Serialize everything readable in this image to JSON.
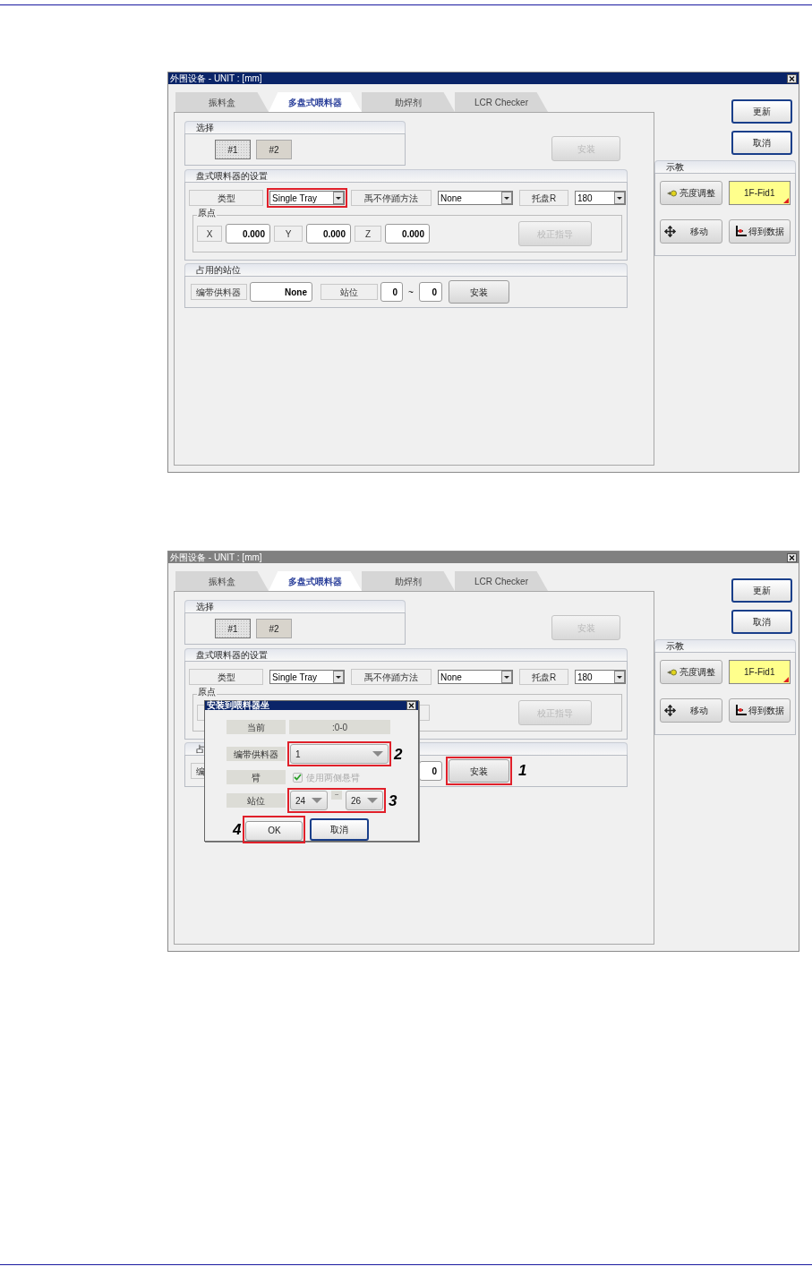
{
  "screens": [
    {
      "window": {
        "title": "外围设备 - UNIT : [mm]",
        "active": true
      },
      "tabs": [
        {
          "label": "振料盒",
          "selected": false
        },
        {
          "label": "多盘式喂料器",
          "selected": true
        },
        {
          "label": "助焊剂",
          "selected": false
        },
        {
          "label": "LCR Checker",
          "selected": false
        }
      ],
      "select_group": {
        "title": "选择",
        "buttons": [
          {
            "label": "#1",
            "selected": true
          },
          {
            "label": "#2",
            "selected": false
          }
        ]
      },
      "install_button": {
        "label": "安装",
        "disabled": true
      },
      "settings": {
        "title": "盘式喂料器的设置",
        "type_label": "类型",
        "type_select": {
          "value": "Single Tray",
          "highlighted": true
        },
        "method_label": "禹不停踊方法",
        "method_select": {
          "value": "None",
          "highlighted": false
        },
        "tray_label": "托盘R",
        "tray_select": {
          "value": "180",
          "highlighted": false
        },
        "origin": {
          "title": "原点",
          "x_label": "X",
          "x_value": "0.000",
          "y_label": "Y",
          "y_value": "0.000",
          "z_label": "Z",
          "z_value": "0.000",
          "calibrate_button": {
            "label": "校正指导",
            "disabled": true
          }
        }
      },
      "occupied": {
        "title": "占用的站位",
        "feeder_label": "编带供料器",
        "feeder_value": "None",
        "station_label": "站位",
        "from": "0",
        "separator": "~",
        "to": "0",
        "install_button": {
          "label": "安装",
          "highlighted": false
        }
      },
      "side": {
        "buttons": [
          "更新",
          "取消"
        ],
        "teach": {
          "title": "示教",
          "brightness": "亮度调整",
          "mark": "1F-Fid1",
          "move": "移动",
          "get_data": "得到数据"
        }
      }
    },
    {
      "window": {
        "title": "外围设备 - UNIT : [mm]",
        "active": false
      },
      "tabs": [
        {
          "label": "振料盒",
          "selected": false
        },
        {
          "label": "多盘式喂料器",
          "selected": true
        },
        {
          "label": "助焊剂",
          "selected": false
        },
        {
          "label": "LCR Checker",
          "selected": false
        }
      ],
      "select_group": {
        "title": "选择",
        "buttons": [
          {
            "label": "#1",
            "selected": true
          },
          {
            "label": "#2",
            "selected": false
          }
        ]
      },
      "install_button": {
        "label": "安装",
        "disabled": true
      },
      "settings": {
        "title": "盘式喂料器的设置",
        "type_label": "类型",
        "type_select": {
          "value": "Single Tray",
          "highlighted": false
        },
        "method_label": "禹不停踊方法",
        "method_select": {
          "value": "None",
          "highlighted": false
        },
        "tray_label": "托盘R",
        "tray_select": {
          "value": "180",
          "highlighted": false
        },
        "origin": {
          "title": "原点",
          "calibrate_button": {
            "label": "校正指导",
            "disabled": true
          }
        }
      },
      "occupied": {
        "title": "占",
        "feeder_label": "编",
        "to": "0",
        "install_button": {
          "label": "安装",
          "highlighted": true,
          "callout": "1"
        }
      },
      "side": {
        "buttons": [
          "更新",
          "取消"
        ],
        "teach": {
          "title": "示教",
          "brightness": "亮度调整",
          "mark": "1F-Fid1",
          "move": "移动",
          "get_data": "得到数据"
        }
      },
      "dialog": {
        "title": "安装到喂料器坐",
        "rows": [
          {
            "kind": "value",
            "label": "当前",
            "value": ":0-0"
          },
          {
            "kind": "select",
            "label": "编带供料器",
            "value": "1",
            "highlighted": true,
            "callout": "2"
          },
          {
            "kind": "checkbox",
            "label": "臂",
            "text": "使用两侧悬臂",
            "checked": true,
            "disabled": true
          },
          {
            "kind": "range",
            "label": "站位",
            "from": "24",
            "separator": "~",
            "to": "26",
            "highlighted": true,
            "callout": "3"
          }
        ],
        "ok": {
          "label": "OK",
          "highlighted": true,
          "callout": "4"
        },
        "cancel": {
          "label": "取消"
        }
      }
    }
  ]
}
